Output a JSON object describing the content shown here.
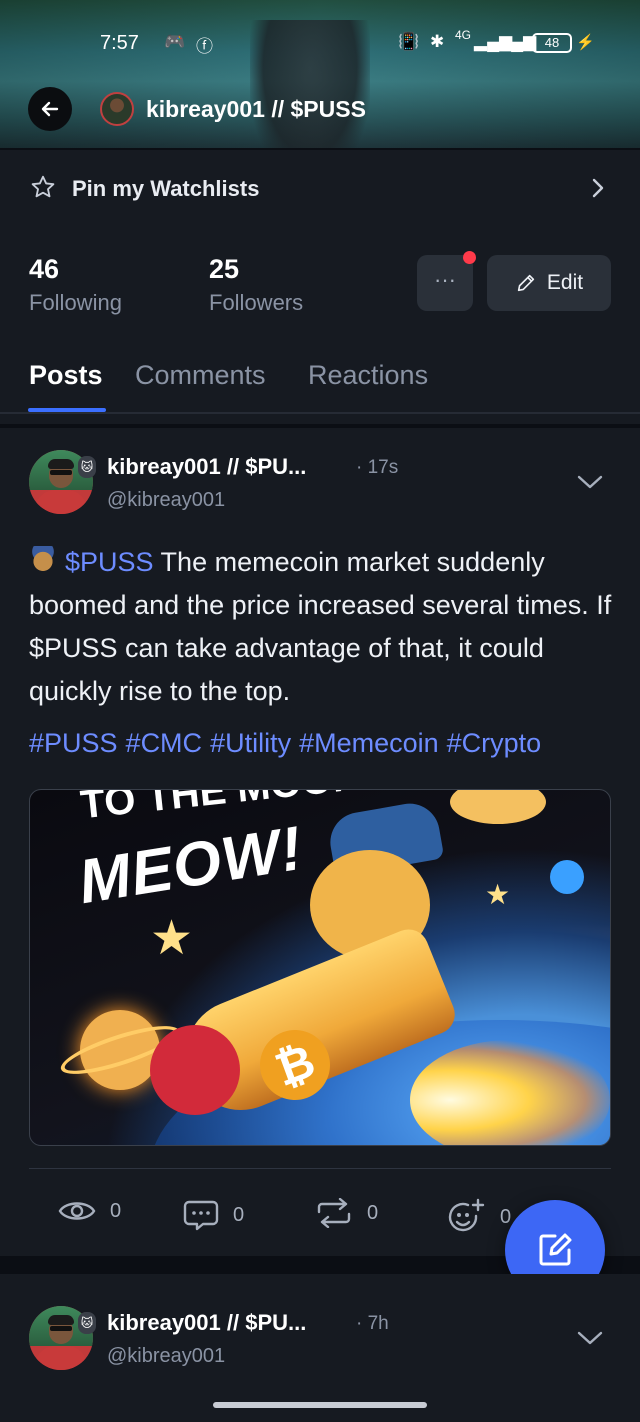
{
  "status_bar": {
    "time": "7:57",
    "network": "4G",
    "battery": "48"
  },
  "header": {
    "title": "kibreay001 // $PUSS"
  },
  "watchlist": {
    "label": "Pin my Watchlists"
  },
  "profile": {
    "following_count": "46",
    "following_label": "Following",
    "followers_count": "25",
    "followers_label": "Followers",
    "more_label": "···",
    "edit_label": "Edit"
  },
  "tabs": [
    {
      "label": "Posts",
      "active": true
    },
    {
      "label": "Comments",
      "active": false
    },
    {
      "label": "Reactions",
      "active": false
    }
  ],
  "posts": [
    {
      "author": "kibreay001 // $PU...",
      "time": "· 17s",
      "handle": "@kibreay001",
      "cashtag": "$PUSS",
      "text": " The memecoin market suddenly boomed and the price increased several times. If $PUSS can take advantage of that, it could quickly rise to the top.",
      "hashtags": [
        "#PUSS",
        "#CMC",
        "#Utility",
        "#Memecoin",
        "#Crypto"
      ],
      "image": {
        "line1": "TO THE MOON!",
        "line2": "MEOW!",
        "coin_symbol": "₿"
      },
      "actions": {
        "views": "0",
        "comments": "0",
        "reposts": "0",
        "reactions": "0"
      }
    },
    {
      "author": "kibreay001 // $PU...",
      "time": "· 7h",
      "handle": "@kibreay001"
    }
  ],
  "colors": {
    "accent": "#3b6fff",
    "link": "#6d8cff",
    "background": "#0b0e14",
    "card": "#161a21",
    "muted": "#8a93a4",
    "notification_dot": "#ff3a4a"
  }
}
